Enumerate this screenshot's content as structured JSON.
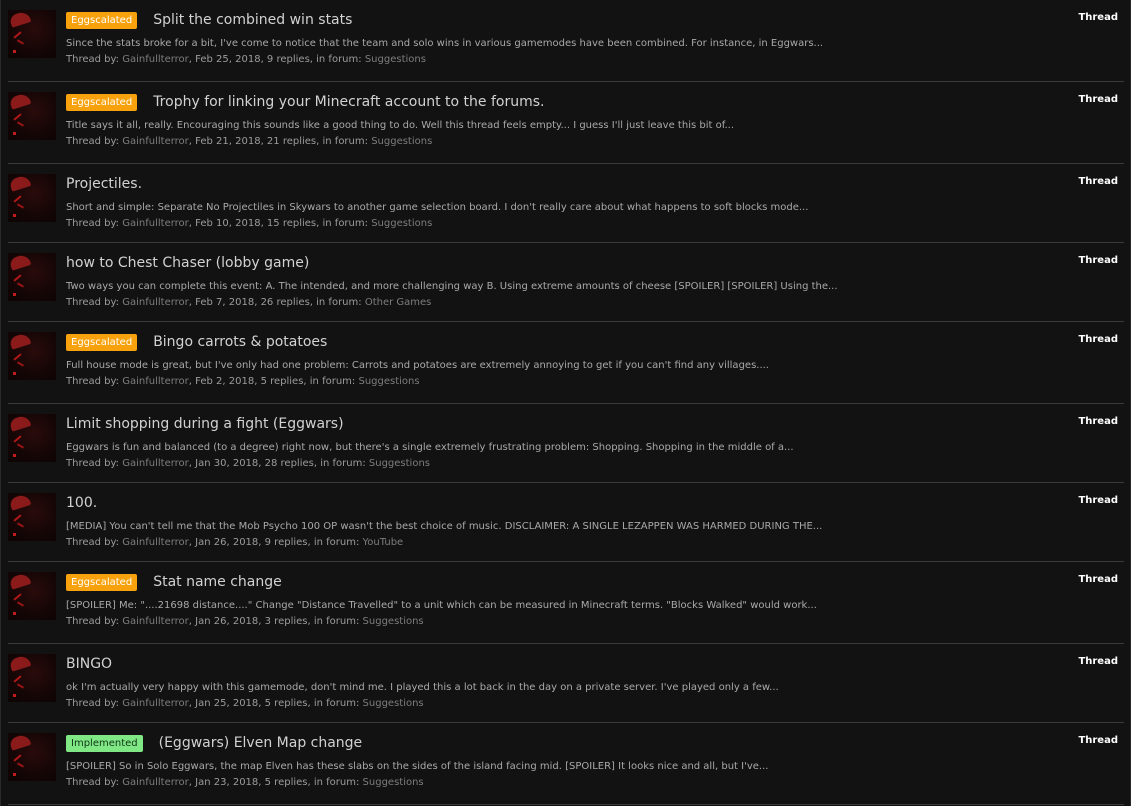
{
  "results": [
    {
      "prefix": "Eggscalated",
      "prefix_color": "#f7a20c",
      "title": "Split the combined win stats",
      "snippet": "Since the stats broke for a bit, I've come to notice that the team and solo wins in various gamemodes have been combined. For instance, in Eggwars...",
      "by_label": "Thread by:",
      "author": "Gainfullterror",
      "details": ", Feb 25, 2018, 9 replies, in forum:",
      "forum": "Suggestions",
      "type": "Thread"
    },
    {
      "prefix": "Eggscalated",
      "prefix_color": "#f7a20c",
      "title": "Trophy for linking your Minecraft account to the forums.",
      "snippet": "Title says it all, really. Encouraging this sounds like a good thing to do. Well this thread feels empty... I guess I'll just leave this bit of...",
      "by_label": "Thread by:",
      "author": "Gainfullterror",
      "details": ", Feb 21, 2018, 21 replies, in forum:",
      "forum": "Suggestions",
      "type": "Thread"
    },
    {
      "prefix": "",
      "title": "Projectiles.",
      "snippet": "Short and simple: Separate No Projectiles in Skywars to another game selection board. I don't really care about what happens to soft blocks mode...",
      "by_label": "Thread by:",
      "author": "Gainfullterror",
      "details": ", Feb 10, 2018, 15 replies, in forum:",
      "forum": "Suggestions",
      "type": "Thread"
    },
    {
      "prefix": "",
      "title": "how to Chest Chaser (lobby game)",
      "snippet": "Two ways you can complete this event: A. The intended, and more challenging way B. Using extreme amounts of cheese [SPOILER] [SPOILER] Using the...",
      "by_label": "Thread by:",
      "author": "Gainfullterror",
      "details": ", Feb 7, 2018, 26 replies, in forum:",
      "forum": "Other Games",
      "type": "Thread"
    },
    {
      "prefix": "Eggscalated",
      "prefix_color": "#f7a20c",
      "title": "Bingo carrots & potatoes",
      "snippet": "Full house mode is great, but I've only had one problem: Carrots and potatoes are extremely annoying to get if you can't find any villages....",
      "by_label": "Thread by:",
      "author": "Gainfullterror",
      "details": ", Feb 2, 2018, 5 replies, in forum:",
      "forum": "Suggestions",
      "type": "Thread"
    },
    {
      "prefix": "",
      "title": "Limit shopping during a fight (Eggwars)",
      "snippet": "Eggwars is fun and balanced (to a degree) right now, but there's a single extremely frustrating problem: Shopping. Shopping in the middle of a...",
      "by_label": "Thread by:",
      "author": "Gainfullterror",
      "details": ", Jan 30, 2018, 28 replies, in forum:",
      "forum": "Suggestions",
      "type": "Thread"
    },
    {
      "prefix": "",
      "title": "100.",
      "snippet": "[MEDIA] You can't tell me that the Mob Psycho 100 OP wasn't the best choice of music. DISCLAIMER: A SINGLE LEZAPPEN WAS HARMED DURING THE...",
      "by_label": "Thread by:",
      "author": "Gainfullterror",
      "details": ", Jan 26, 2018, 9 replies, in forum:",
      "forum": "YouTube",
      "type": "Thread"
    },
    {
      "prefix": "Eggscalated",
      "prefix_color": "#f7a20c",
      "title": "Stat name change",
      "snippet": "[SPOILER] Me: \"....21698 distance....\" Change \"Distance Travelled\" to a unit which can be measured in Minecraft terms. \"Blocks Walked\" would work...",
      "by_label": "Thread by:",
      "author": "Gainfullterror",
      "details": ", Jan 26, 2018, 3 replies, in forum:",
      "forum": "Suggestions",
      "type": "Thread"
    },
    {
      "prefix": "",
      "title": "BINGO",
      "snippet": "ok I'm actually very happy with this gamemode, don't mind me. I played this a lot back in the day on a private server. I've played only a few...",
      "by_label": "Thread by:",
      "author": "Gainfullterror",
      "details": ", Jan 25, 2018, 5 replies, in forum:",
      "forum": "Suggestions",
      "type": "Thread"
    },
    {
      "prefix": "Implemented",
      "prefix_color": "#7fe884",
      "title": "(Eggwars) Elven Map change",
      "snippet": "[SPOILER] So in Solo Eggwars, the map Elven has these slabs on the sides of the island facing mid. [SPOILER] It looks nice and all, but I've...",
      "by_label": "Thread by:",
      "author": "Gainfullterror",
      "details": ", Jan 23, 2018, 5 replies, in forum:",
      "forum": "Suggestions",
      "type": "Thread"
    }
  ]
}
